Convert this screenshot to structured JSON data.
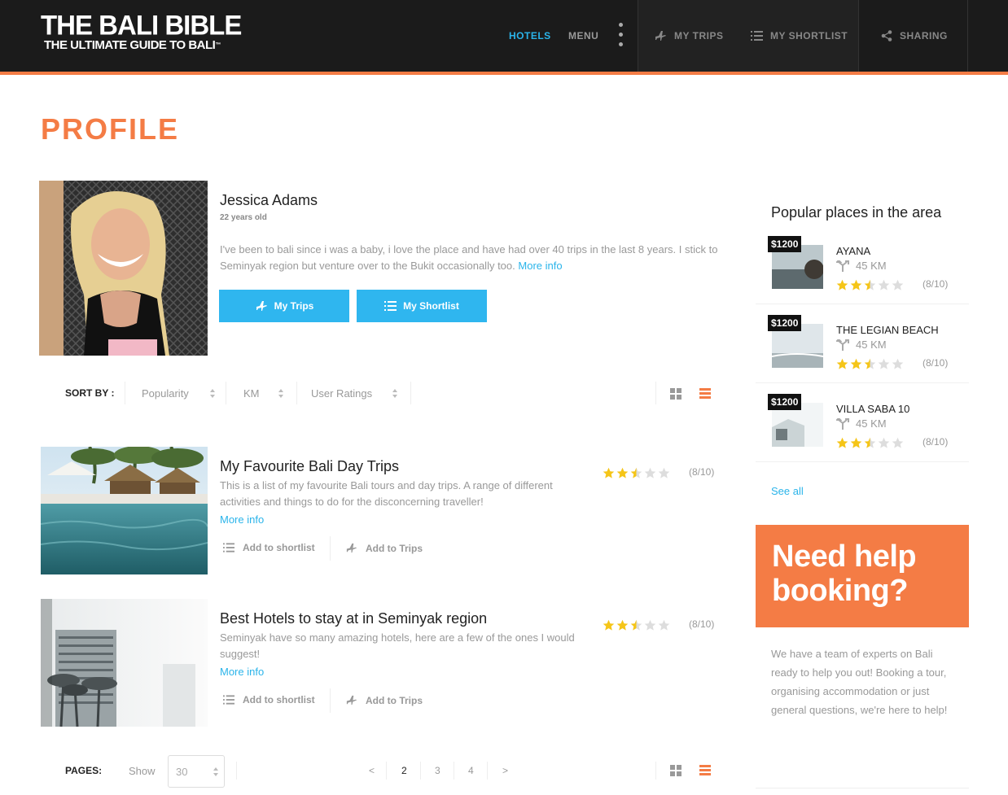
{
  "brand": {
    "line1": "THE BALI BIBLE",
    "line2": "THE ULTIMATE GUIDE TO BALI",
    "tm": "™"
  },
  "nav": {
    "hotels": "HOTELS",
    "menu": "MENU",
    "my_trips": "MY TRIPS",
    "my_shortlist": "MY SHORTLIST",
    "sharing": "SHARING"
  },
  "page_title": "PROFILE",
  "profile": {
    "name": "Jessica Adams",
    "age": "22 years old",
    "bio": "I've been to bali since i was a baby, i love the place and have had over 40 trips in the last 8 years. I stick to Seminyak region but venture over to the Bukit occasionally too.",
    "more": "More info",
    "btn_trips": "My Trips",
    "btn_shortlist": "My Shortlist"
  },
  "sort": {
    "label": "SORT BY :",
    "options": [
      "Popularity",
      "KM",
      "User Ratings"
    ]
  },
  "cards": [
    {
      "title": "My Favourite Bali Day Trips",
      "desc": "This is a list of my favourite Bali tours and day trips. A range of different activities and things to do for the disconcerning traveller!",
      "more": "More info",
      "rating": "(8/10)",
      "stars": 2.5,
      "add_shortlist": "Add to shortlist",
      "add_trips": "Add to Trips"
    },
    {
      "title": "Best Hotels to stay at in Seminyak region",
      "desc": "Seminyak have so many amazing hotels, here are a few of the ones I would suggest!",
      "more": "More info",
      "rating": "(8/10)",
      "stars": 2.5,
      "add_shortlist": "Add to shortlist",
      "add_trips": "Add to Trips"
    }
  ],
  "pager": {
    "label": "PAGES:",
    "show": "Show",
    "per_page": "30",
    "prev": "<",
    "pages": [
      "2",
      "3",
      "4"
    ],
    "next": ">"
  },
  "sidebar": {
    "title": "Popular places in the area",
    "places": [
      {
        "name": "AYANA",
        "price": "$1200",
        "km": "45 KM",
        "rating": "(8/10)",
        "stars": 2.5
      },
      {
        "name": "THE LEGIAN BEACH",
        "price": "$1200",
        "km": "45 KM",
        "rating": "(8/10)",
        "stars": 2.5
      },
      {
        "name": "VILLA SABA 10",
        "price": "$1200",
        "km": "45 KM",
        "rating": "(8/10)",
        "stars": 2.5
      }
    ],
    "see_all": "See all",
    "help_title": "Need help booking?",
    "help_text": "We have a team of experts on Bali ready to help you out! Booking a tour, organising accommodation or just general questions, we're here to help!"
  },
  "colors": {
    "accent": "#f47c45",
    "blue": "#2ab4ea",
    "star": "#f5c518",
    "topbar": "#1b1b1b"
  }
}
